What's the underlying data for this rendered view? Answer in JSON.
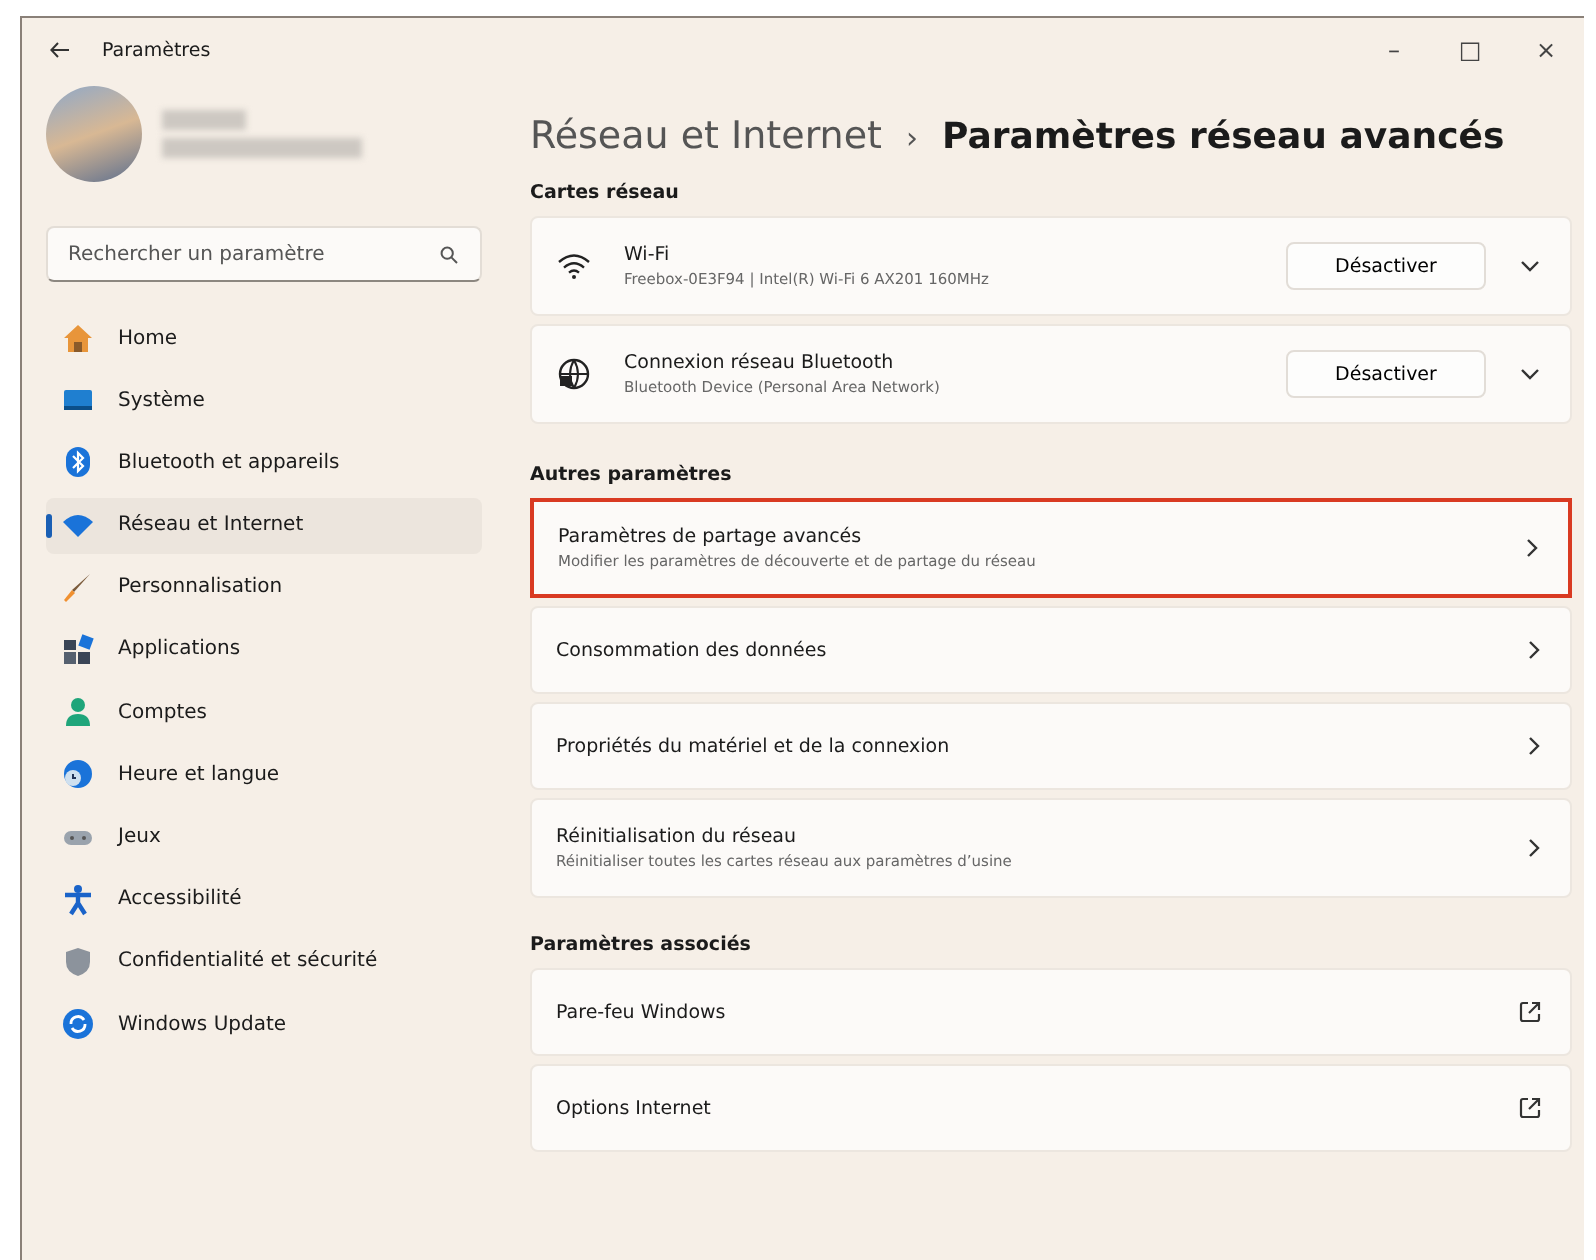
{
  "window": {
    "title": "Paramètres",
    "controls": [
      "–",
      "□",
      "×"
    ]
  },
  "sidebar": {
    "search": {
      "placeholder": "Rechercher un paramètre"
    },
    "items": [
      {
        "label": "Home",
        "kind": "home",
        "selected": false
      },
      {
        "label": "Système",
        "kind": "system",
        "selected": false
      },
      {
        "label": "Bluetooth et appareils",
        "kind": "bluetooth",
        "selected": false
      },
      {
        "label": "Réseau et Internet",
        "kind": "wifi",
        "selected": true
      },
      {
        "label": "Personnalisation",
        "kind": "brush",
        "selected": false
      },
      {
        "label": "Applications",
        "kind": "apps",
        "selected": false
      },
      {
        "label": "Comptes",
        "kind": "person",
        "selected": false
      },
      {
        "label": "Heure et langue",
        "kind": "clock",
        "selected": false
      },
      {
        "label": "Jeux",
        "kind": "gamepad",
        "selected": false
      },
      {
        "label": "Accessibilité",
        "kind": "accessibility",
        "selected": false
      },
      {
        "label": "Confidentialité et sécurité",
        "kind": "shield",
        "selected": false
      },
      {
        "label": "Windows Update",
        "kind": "update",
        "selected": false
      }
    ]
  },
  "breadcrumb": {
    "parent": "Réseau et Internet",
    "separator": "›",
    "current": "Paramètres réseau avancés"
  },
  "sections": [
    {
      "title": "Cartes réseau",
      "items": [
        {
          "kind": "adapter",
          "title": "Wi-Fi",
          "subtitle": "Freebox-0E3F94 | Intel(R) Wi-Fi 6 AX201 160MHz",
          "button": "Désactiver",
          "highlighted": false
        },
        {
          "kind": "adapter",
          "title": "Connexion réseau Bluetooth",
          "subtitle": "Bluetooth Device (Personal Area Network)",
          "button": "Désactiver",
          "highlighted": false
        }
      ]
    },
    {
      "title": "Autres paramètres",
      "items": [
        {
          "kind": "nav",
          "title": "Paramètres de partage avancés",
          "subtitle": "Modifier les paramètres de découverte et de partage du réseau",
          "highlighted": true
        },
        {
          "kind": "nav",
          "title": "Consommation des données",
          "highlighted": false
        },
        {
          "kind": "nav",
          "title": "Propriétés du matériel et de la connexion",
          "highlighted": false
        },
        {
          "kind": "nav",
          "title": "Réinitialisation du réseau",
          "subtitle": "Réinitialiser toutes les cartes réseau aux paramètres d’usine",
          "highlighted": false
        }
      ]
    },
    {
      "title": "Paramètres associés",
      "items": [
        {
          "kind": "external",
          "title": "Pare-feu Windows",
          "highlighted": false
        },
        {
          "kind": "external",
          "title": "Options Internet",
          "highlighted": false
        }
      ]
    }
  ]
}
